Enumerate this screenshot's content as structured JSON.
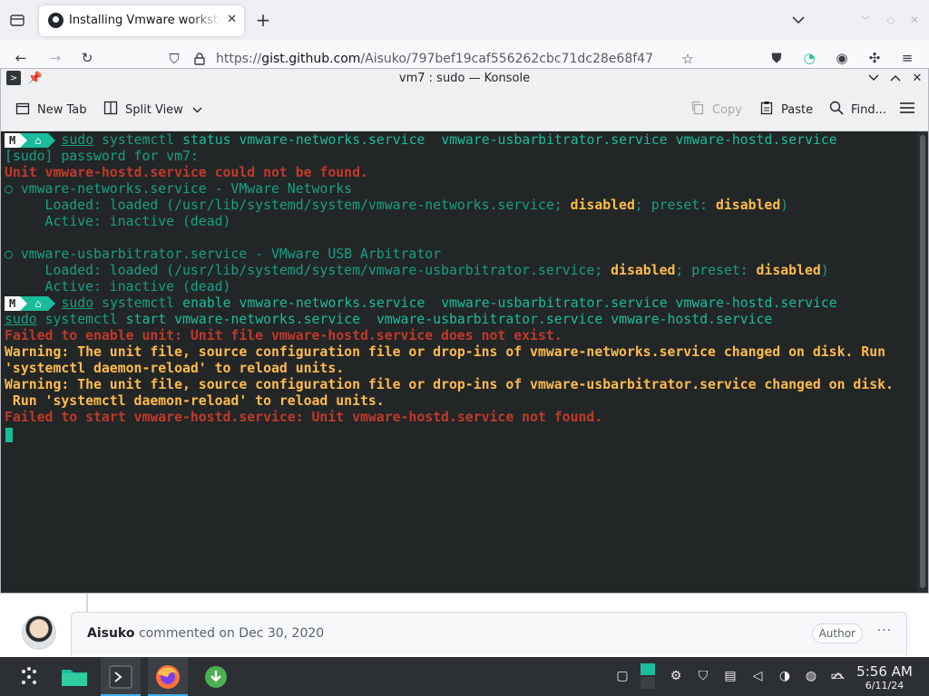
{
  "browser": {
    "tab_title": "Installing Vmware workstation",
    "url_prefix": "https://",
    "url_domain": "gist.github.com",
    "url_path": "/Aisuko/797bef19caf556262cbc71dc28e68f47",
    "new_tab_glyph": "+"
  },
  "konsole": {
    "title": "vm7 : sudo — Konsole",
    "toolbar": {
      "new_tab": "New Tab",
      "split_view": "Split View",
      "copy": "Copy",
      "paste": "Paste",
      "find": "Find..."
    }
  },
  "terminal": {
    "prompt_host_glyph": "M",
    "prompt_home_glyph": "⌂",
    "lines": {
      "l1_cmd": "sudo",
      "l1_rest_a": "systemctl",
      "l1_rest_b": " status vmware-networks.service  vmware-usbarbitrator.service vmware-hostd.service",
      "l2": "[sudo] password for vm7:",
      "l3": "Unit vmware-hostd.service could not be found.",
      "l4": "○ vmware-networks.service - VMware Networks",
      "l5_a": "     Loaded: loaded (/usr/lib/systemd/system/vmware-networks.service; ",
      "l5_b": "disabled",
      "l5_c": "; preset: ",
      "l5_d": "disabled",
      "l5_e": ")",
      "l6": "     Active: inactive (dead)",
      "l8": "○ vmware-usbarbitrator.service - VMware USB Arbitrator",
      "l9_a": "     Loaded: loaded (/usr/lib/systemd/system/vmware-usbarbitrator.service; ",
      "l9_b": "disabled",
      "l9_c": "; preset: ",
      "l9_d": "disabled",
      "l9_e": ")",
      "l10": "     Active: inactive (dead)",
      "l11_cmd": "sudo",
      "l11_rest_a": "systemctl",
      "l11_rest_b": " enable vmware-networks.service  vmware-usbarbitrator.service vmware-hostd.service",
      "l12_cmd": "sudo",
      "l12_rest_a": "systemctl",
      "l12_rest_b": " start vmware-networks.service  vmware-usbarbitrator.service vmware-hostd.service",
      "l13": "Failed to enable unit: Unit file vmware-hostd.service does not exist.",
      "l14": "Warning: The unit file, source configuration file or drop-ins of vmware-networks.service changed on disk. Run",
      "l15": "'systemctl daemon-reload' to reload units.",
      "l16": "Warning: The unit file, source configuration file or drop-ins of vmware-usbarbitrator.service changed on disk.",
      "l17": " Run 'systemctl daemon-reload' to reload units.",
      "l18": "Failed to start vmware-hostd.service: Unit vmware-hostd.service not found."
    }
  },
  "github": {
    "author": "Aisuko",
    "action": " commented on Dec 30, 2020",
    "badge": "Author",
    "more": "···"
  },
  "panel": {
    "time": "5:56 AM",
    "date": "6/11/24"
  },
  "colors": {
    "terminal_bg": "#232627",
    "accent": "#1abc9c",
    "error": "#c0392b",
    "warning": "#fdbc4b"
  }
}
